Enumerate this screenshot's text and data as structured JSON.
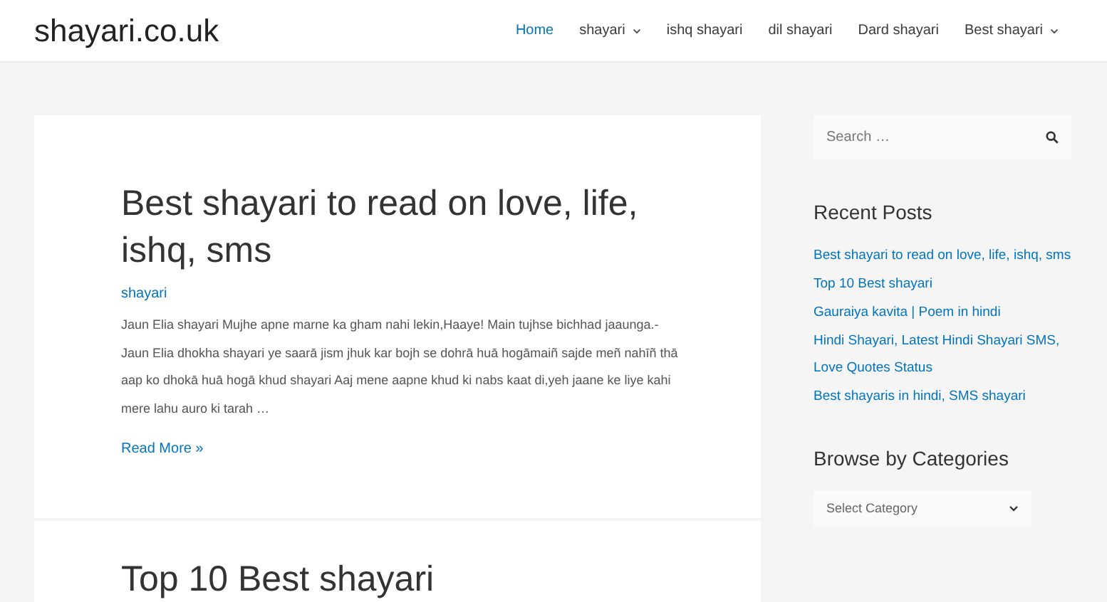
{
  "site_title": "shayari.co.uk",
  "nav": [
    {
      "label": "Home",
      "selected": true,
      "dropdown": false
    },
    {
      "label": "shayari",
      "selected": false,
      "dropdown": true
    },
    {
      "label": "ishq shayari",
      "selected": false,
      "dropdown": false
    },
    {
      "label": "dil shayari",
      "selected": false,
      "dropdown": false
    },
    {
      "label": "Dard shayari",
      "selected": false,
      "dropdown": false
    },
    {
      "label": "Best shayari",
      "selected": false,
      "dropdown": true
    }
  ],
  "posts": [
    {
      "title": "Best shayari to read on love, life, ishq, sms",
      "category": "shayari",
      "excerpt": "Jaun Elia shayari Mujhe apne marne ka gham nahi lekin,Haaye! Main tujhse bichhad jaaunga.- Jaun Elia dhokha shayari ye saarā jism jhuk kar bojh se dohrā huā hogāmaiñ sajde meñ nahīñ thā aap ko dhokā huā hogā khud shayari Aaj mene aapne khud ki nabs kaat di,yeh jaane ke liye kahi mere lahu auro ki tarah …",
      "read_more": "Read More »"
    },
    {
      "title": "Top 10 Best shayari"
    }
  ],
  "sidebar": {
    "search": {
      "placeholder": "Search …"
    },
    "recent_posts": {
      "heading": "Recent Posts",
      "items": [
        "Best shayari to read on love, life, ishq, sms",
        "Top 10 Best shayari",
        "Gauraiya kavita | Poem in hindi",
        "Hindi Shayari, Latest Hindi Shayari SMS, Love Quotes Status",
        "Best shayaris in hindi, SMS shayari"
      ]
    },
    "categories": {
      "heading": "Browse by Categories",
      "select": "Select Category"
    }
  }
}
